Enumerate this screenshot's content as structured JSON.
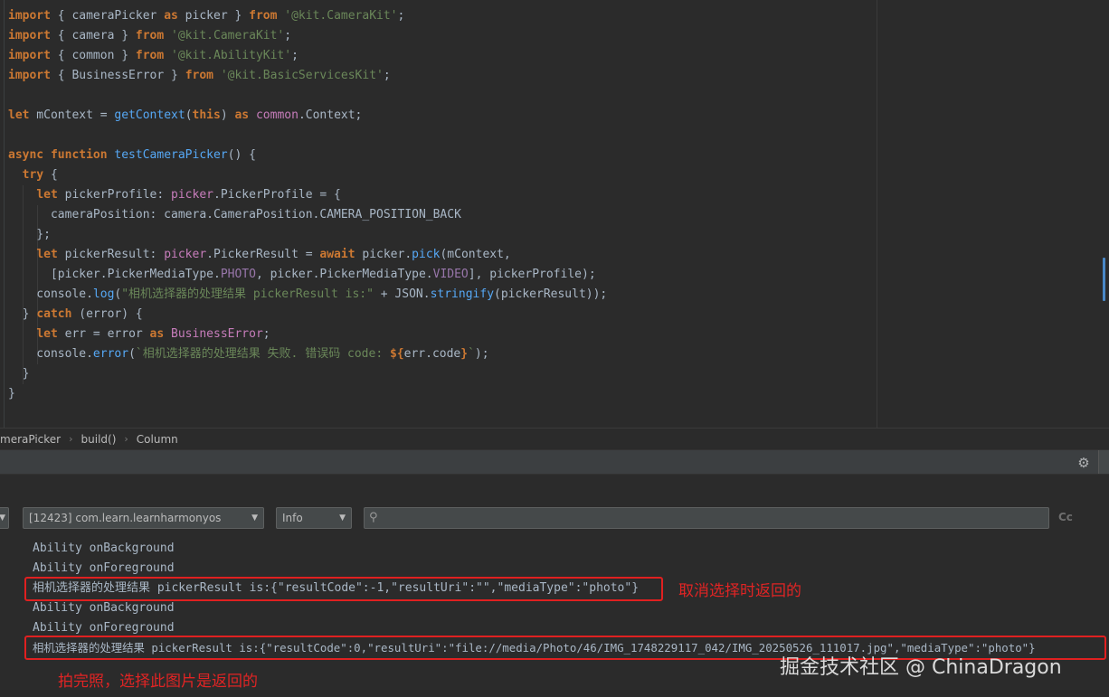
{
  "code_lines": [
    [
      [
        "kw",
        "import"
      ],
      [
        "plain",
        " { cameraPicker "
      ],
      [
        "kw",
        "as"
      ],
      [
        "plain",
        " picker } "
      ],
      [
        "kw",
        "from"
      ],
      [
        "plain",
        " "
      ],
      [
        "str",
        "'@kit.CameraKit'"
      ],
      [
        "plain",
        ";"
      ]
    ],
    [
      [
        "kw",
        "import"
      ],
      [
        "plain",
        " { camera } "
      ],
      [
        "kw",
        "from"
      ],
      [
        "plain",
        " "
      ],
      [
        "str",
        "'@kit.CameraKit'"
      ],
      [
        "plain",
        ";"
      ]
    ],
    [
      [
        "kw",
        "import"
      ],
      [
        "plain",
        " { common } "
      ],
      [
        "kw",
        "from"
      ],
      [
        "plain",
        " "
      ],
      [
        "str",
        "'@kit.AbilityKit'"
      ],
      [
        "plain",
        ";"
      ]
    ],
    [
      [
        "kw",
        "import"
      ],
      [
        "plain",
        " { BusinessError } "
      ],
      [
        "kw",
        "from"
      ],
      [
        "plain",
        " "
      ],
      [
        "str",
        "'@kit.BasicServicesKit'"
      ],
      [
        "plain",
        ";"
      ]
    ],
    [],
    [
      [
        "kw",
        "let"
      ],
      [
        "plain",
        " mContext = "
      ],
      [
        "fn",
        "getContext"
      ],
      [
        "plain",
        "("
      ],
      [
        "kw",
        "this"
      ],
      [
        "plain",
        ") "
      ],
      [
        "kw",
        "as"
      ],
      [
        "plain",
        " "
      ],
      [
        "ty",
        "common"
      ],
      [
        "plain",
        ".Context;"
      ]
    ],
    [],
    [
      [
        "kw",
        "async function"
      ],
      [
        "plain",
        " "
      ],
      [
        "fn",
        "testCameraPicker"
      ],
      [
        "plain",
        "() {"
      ]
    ],
    [
      [
        "plain",
        "  "
      ],
      [
        "kw",
        "try"
      ],
      [
        "plain",
        " {"
      ]
    ],
    [
      [
        "plain",
        "    "
      ],
      [
        "kw",
        "let"
      ],
      [
        "plain",
        " pickerProfile: "
      ],
      [
        "ty",
        "picker"
      ],
      [
        "plain",
        ".PickerProfile = {"
      ]
    ],
    [
      [
        "plain",
        "      cameraPosition: camera.CameraPosition.CAMERA_POSITION_BACK"
      ]
    ],
    [
      [
        "plain",
        "    };"
      ]
    ],
    [
      [
        "plain",
        "    "
      ],
      [
        "kw",
        "let"
      ],
      [
        "plain",
        " pickerResult: "
      ],
      [
        "ty",
        "picker"
      ],
      [
        "plain",
        ".PickerResult = "
      ],
      [
        "kw",
        "await"
      ],
      [
        "plain",
        " picker."
      ],
      [
        "fn",
        "pick"
      ],
      [
        "plain",
        "(mContext,"
      ]
    ],
    [
      [
        "plain",
        "      [picker.PickerMediaType."
      ],
      [
        "mod",
        "PHOTO"
      ],
      [
        "plain",
        ", picker.PickerMediaType."
      ],
      [
        "mod",
        "VIDEO"
      ],
      [
        "plain",
        "], pickerProfile);"
      ]
    ],
    [
      [
        "plain",
        "    console."
      ],
      [
        "fn",
        "log"
      ],
      [
        "plain",
        "("
      ],
      [
        "str",
        "\"相机选择器的处理结果 pickerResult is:\""
      ],
      [
        "plain",
        " + JSON."
      ],
      [
        "fn",
        "stringify"
      ],
      [
        "plain",
        "(pickerResult));"
      ]
    ],
    [
      [
        "plain",
        "  } "
      ],
      [
        "kw",
        "catch"
      ],
      [
        "plain",
        " (error) {"
      ]
    ],
    [
      [
        "plain",
        "    "
      ],
      [
        "kw",
        "let"
      ],
      [
        "plain",
        " err = error "
      ],
      [
        "kw",
        "as"
      ],
      [
        "plain",
        " "
      ],
      [
        "ty",
        "BusinessError"
      ],
      [
        "plain",
        ";"
      ]
    ],
    [
      [
        "plain",
        "    console."
      ],
      [
        "fn",
        "error"
      ],
      [
        "plain",
        "("
      ],
      [
        "str",
        "`相机选择器的处理结果 失败. 错误码 code: "
      ],
      [
        "kw",
        "${"
      ],
      [
        "plain",
        "err.code"
      ],
      [
        "kw",
        "}"
      ],
      [
        "str",
        "`"
      ],
      [
        "plain",
        ");"
      ]
    ],
    [
      [
        "plain",
        "  }"
      ]
    ],
    [
      [
        "plain",
        "}"
      ]
    ]
  ],
  "colors": {
    "keyword": "#cc7832",
    "string": "#6a8759",
    "function": "#56a8f5",
    "type": "#c77dbb",
    "text": "#a9b7c6",
    "annotation_red": "#e02424"
  },
  "breadcrumb": [
    "meraPicker",
    "build()",
    "Column"
  ],
  "filter": {
    "process": "[12423] com.learn.learnharmonyos",
    "level": "Info",
    "search_placeholder": "",
    "case_toggle": "Cc"
  },
  "icons": {
    "settings": "gear-icon",
    "search": "search-icon",
    "dropdown": "chevron-down-icon"
  },
  "log": [
    {
      "text": "Ability onBackground"
    },
    {
      "text": "Ability onForeground"
    },
    {
      "text": "相机选择器的处理结果 pickerResult is:{\"resultCode\":-1,\"resultUri\":\"\",\"mediaType\":\"photo\"}"
    },
    {
      "text": "Ability onBackground"
    },
    {
      "text": "Ability onForeground"
    },
    {
      "text": "相机选择器的处理结果 pickerResult is:{\"resultCode\":0,\"resultUri\":\"file://media/Photo/46/IMG_1748229117_042/IMG_20250526_111017.jpg\",\"mediaType\":\"photo\"}"
    }
  ],
  "annotations": {
    "cancel_note": "取消选择时返回的",
    "photo_note": "拍完照，选择此图片是返回的"
  },
  "watermark": "掘金技术社区 @ ChinaDragon"
}
